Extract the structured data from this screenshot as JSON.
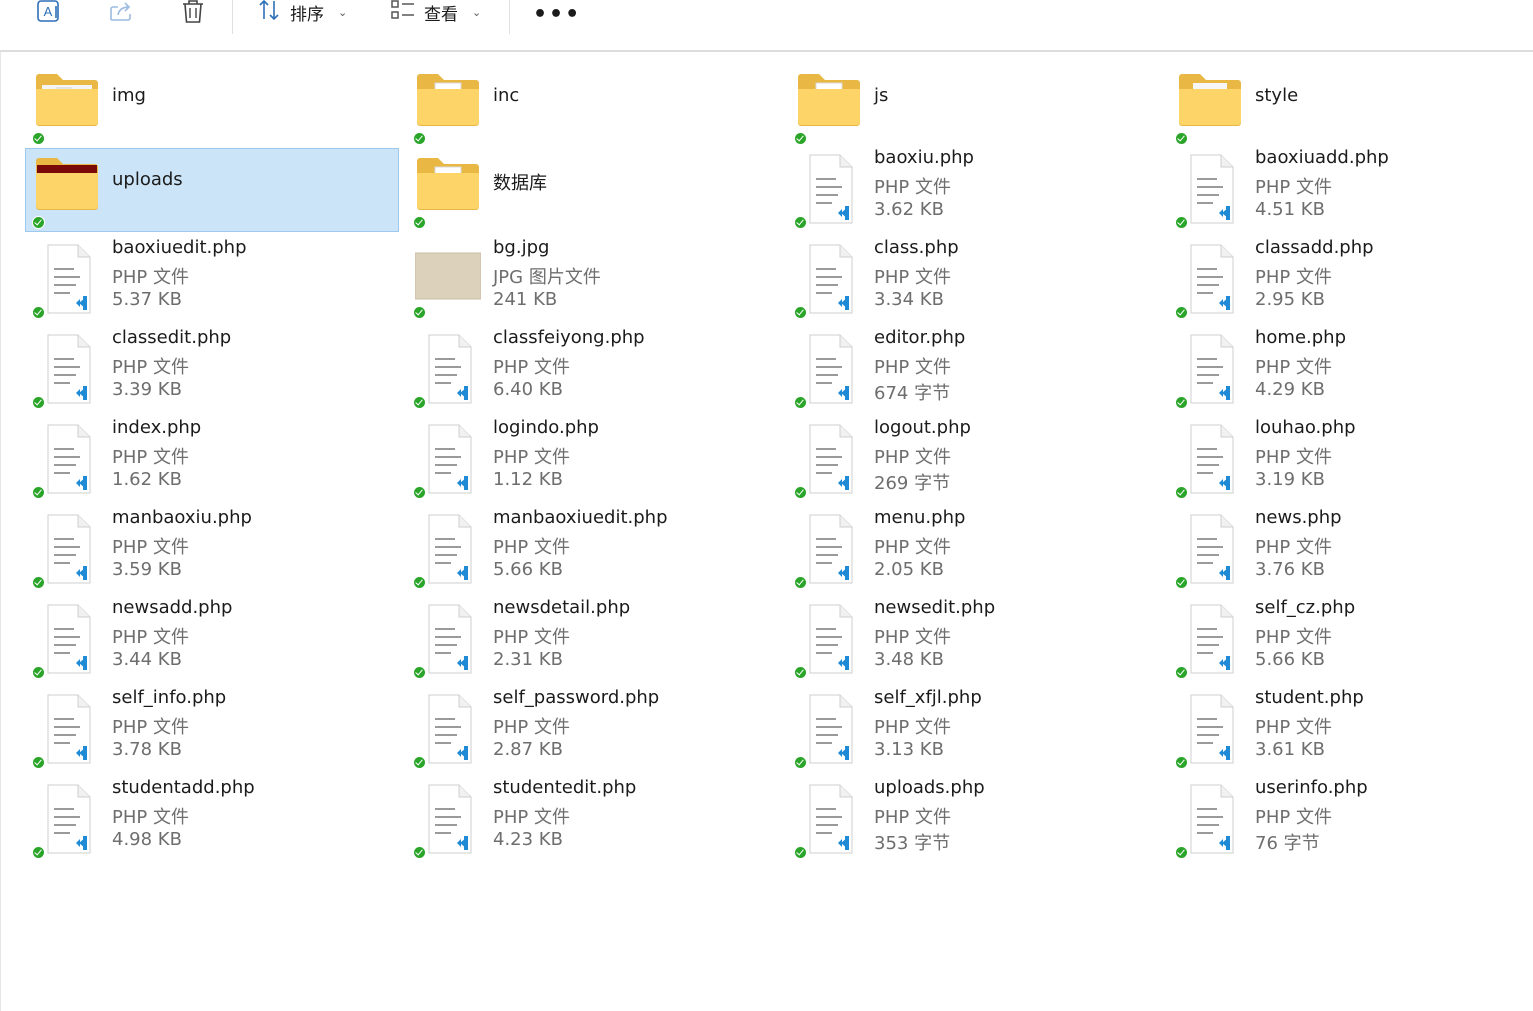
{
  "toolbar": {
    "icons": [
      "rename-icon",
      "share-icon",
      "delete-icon"
    ],
    "sort_label": "排序",
    "view_label": "查看",
    "more_label": "•••"
  },
  "folders": [
    {
      "name": "img",
      "thumb": "img"
    },
    {
      "name": "inc",
      "thumb": "doc"
    },
    {
      "name": "js",
      "thumb": "doc"
    },
    {
      "name": "style",
      "thumb": "style"
    },
    {
      "name": "uploads",
      "thumb": "red",
      "selected": true
    },
    {
      "name": "数据库",
      "thumb": "doc"
    }
  ],
  "files": [
    {
      "name": "baoxiu.php",
      "type": "PHP 文件",
      "size": "3.62 KB"
    },
    {
      "name": "baoxiuadd.php",
      "type": "PHP 文件",
      "size": "4.51 KB"
    },
    {
      "name": "baoxiuedit.php",
      "type": "PHP 文件",
      "size": "5.37 KB"
    },
    {
      "name": "bg.jpg",
      "type": "JPG 图片文件",
      "size": "241 KB",
      "kind": "jpg"
    },
    {
      "name": "class.php",
      "type": "PHP 文件",
      "size": "3.34 KB"
    },
    {
      "name": "classadd.php",
      "type": "PHP 文件",
      "size": "2.95 KB"
    },
    {
      "name": "classedit.php",
      "type": "PHP 文件",
      "size": "3.39 KB"
    },
    {
      "name": "classfeiyong.php",
      "type": "PHP 文件",
      "size": "6.40 KB"
    },
    {
      "name": "editor.php",
      "type": "PHP 文件",
      "size": "674 字节"
    },
    {
      "name": "home.php",
      "type": "PHP 文件",
      "size": "4.29 KB"
    },
    {
      "name": "index.php",
      "type": "PHP 文件",
      "size": "1.62 KB"
    },
    {
      "name": "logindo.php",
      "type": "PHP 文件",
      "size": "1.12 KB"
    },
    {
      "name": "logout.php",
      "type": "PHP 文件",
      "size": "269 字节"
    },
    {
      "name": "louhao.php",
      "type": "PHP 文件",
      "size": "3.19 KB"
    },
    {
      "name": "manbaoxiu.php",
      "type": "PHP 文件",
      "size": "3.59 KB"
    },
    {
      "name": "manbaoxiuedit.php",
      "type": "PHP 文件",
      "size": "5.66 KB"
    },
    {
      "name": "menu.php",
      "type": "PHP 文件",
      "size": "2.05 KB"
    },
    {
      "name": "news.php",
      "type": "PHP 文件",
      "size": "3.76 KB"
    },
    {
      "name": "newsadd.php",
      "type": "PHP 文件",
      "size": "3.44 KB"
    },
    {
      "name": "newsdetail.php",
      "type": "PHP 文件",
      "size": "2.31 KB"
    },
    {
      "name": "newsedit.php",
      "type": "PHP 文件",
      "size": "3.48 KB"
    },
    {
      "name": "self_cz.php",
      "type": "PHP 文件",
      "size": "5.66 KB"
    },
    {
      "name": "self_info.php",
      "type": "PHP 文件",
      "size": "3.78 KB"
    },
    {
      "name": "self_password.php",
      "type": "PHP 文件",
      "size": "2.87 KB"
    },
    {
      "name": "self_xfjl.php",
      "type": "PHP 文件",
      "size": "3.13 KB"
    },
    {
      "name": "student.php",
      "type": "PHP 文件",
      "size": "3.61 KB"
    },
    {
      "name": "studentadd.php",
      "type": "PHP 文件",
      "size": "4.98 KB"
    },
    {
      "name": "studentedit.php",
      "type": "PHP 文件",
      "size": "4.23 KB"
    },
    {
      "name": "uploads.php",
      "type": "PHP 文件",
      "size": "353 字节"
    },
    {
      "name": "userinfo.php",
      "type": "PHP 文件",
      "size": "76 字节"
    }
  ]
}
